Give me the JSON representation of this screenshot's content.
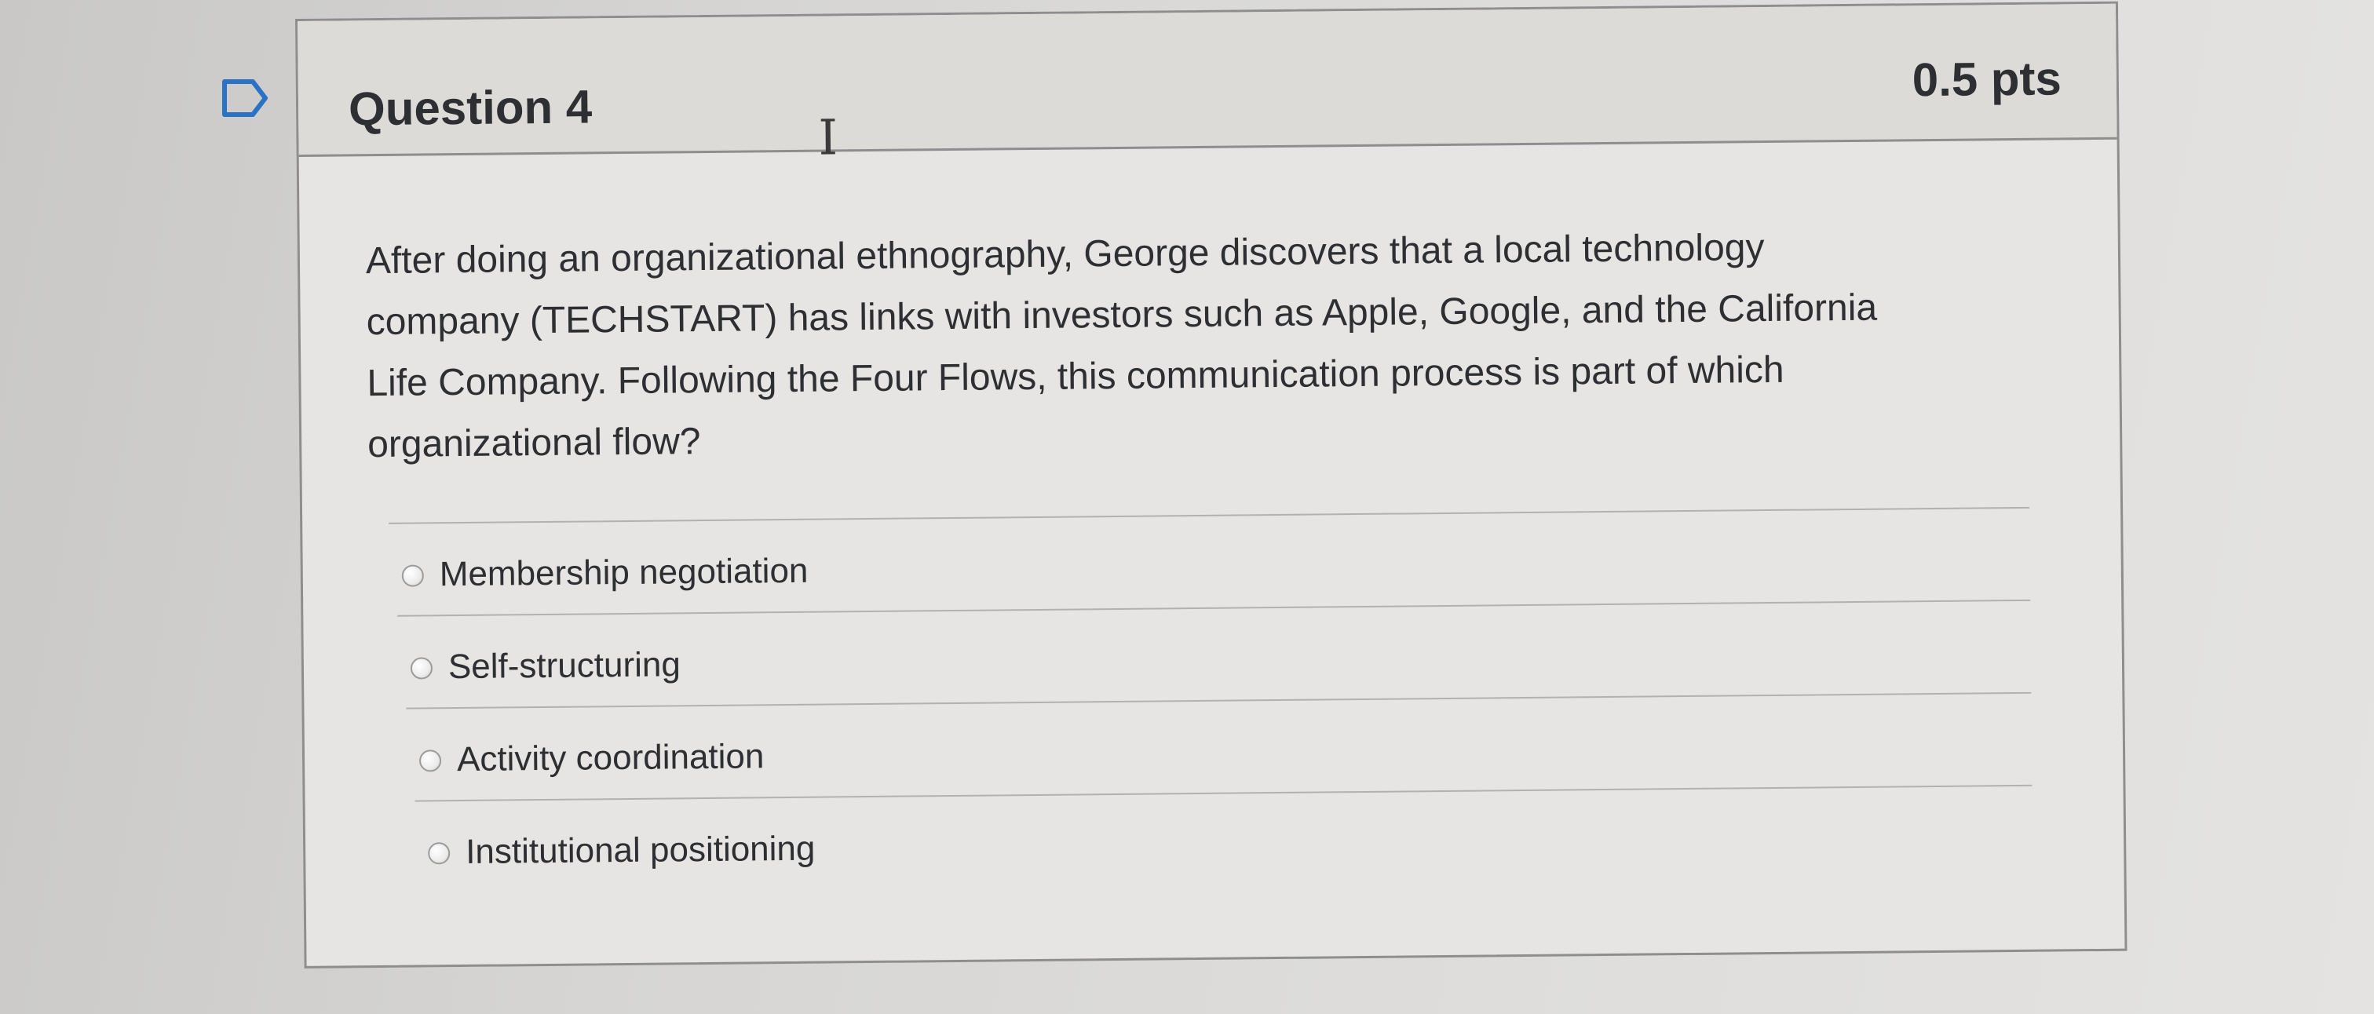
{
  "question": {
    "title": "Question 4",
    "points": "0.5 pts",
    "body_lines": [
      "After doing an organizational ethnography, George discovers that a local technology",
      "company (TECHSTART) has links with investors such as Apple, Google, and the California",
      "Life Company. Following the Four Flows, this communication process is part of which",
      "organizational flow?"
    ],
    "answers": [
      "Membership negotiation",
      "Self-structuring",
      "Activity coordination",
      "Institutional positioning"
    ]
  },
  "icons": {
    "flag": "bookmark-flag-icon",
    "cursor": "text-cursor-icon",
    "radio": "radio-button-icon"
  }
}
